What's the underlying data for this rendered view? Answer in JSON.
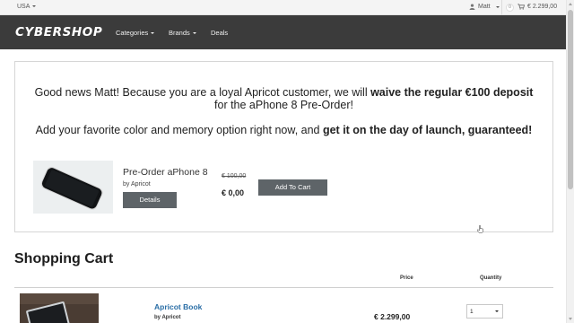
{
  "topbar": {
    "country": "USA",
    "user": "Matt",
    "cart_count": "0",
    "cart_total": "€ 2.299,00"
  },
  "navbar": {
    "logo": "CYBERSHOP",
    "items": [
      {
        "label": "Categories",
        "dropdown": true
      },
      {
        "label": "Brands",
        "dropdown": true
      },
      {
        "label": "Deals",
        "dropdown": false
      }
    ]
  },
  "promo": {
    "line1_plain": "Good news Matt! Because you are a loyal Apricot customer, we will ",
    "line1_bold": "waive the regular €100 deposit",
    "line1_tail": " for the aPhone 8 Pre-Order!",
    "line2_plain": "Add your favorite color and memory option right now, and ",
    "line2_bold": "get it on the day of launch, guaranteed!",
    "product": {
      "name": "Pre-Order aPhone 8",
      "by": "by Apricot",
      "details_label": "Details",
      "old_price": "€ 100,00",
      "new_price": "€ 0,00",
      "add_label": "Add To Cart"
    }
  },
  "cart": {
    "title": "Shopping Cart",
    "columns": {
      "price": "Price",
      "quantity": "Quantity"
    },
    "rows": [
      {
        "name": "Apricot Book",
        "by": "by Apricot",
        "price": "€ 2.299,00",
        "quantity": "1"
      }
    ]
  },
  "colors": {
    "navbar_bg": "#3b3b3b",
    "button_bg": "#5e6468",
    "link": "#2a6ea6"
  }
}
